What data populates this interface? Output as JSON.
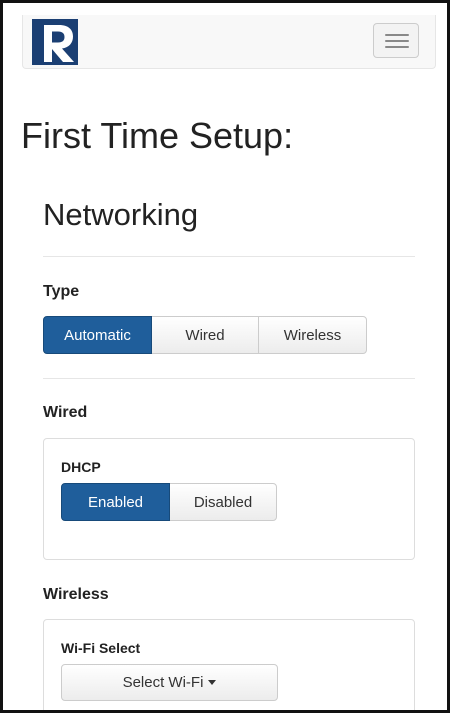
{
  "navbar": {
    "logo_letter": "R",
    "menu_icon": "hamburger-menu-icon"
  },
  "page": {
    "title": "First Time Setup:"
  },
  "networking": {
    "title": "Networking",
    "type_label": "Type",
    "type_options": [
      "Automatic",
      "Wired",
      "Wireless"
    ],
    "type_selected": "Automatic",
    "wired": {
      "title": "Wired",
      "dhcp_label": "DHCP",
      "dhcp_options": [
        "Enabled",
        "Disabled"
      ],
      "dhcp_selected": "Enabled"
    },
    "wireless": {
      "title": "Wireless",
      "wifi_label": "Wi-Fi Select",
      "wifi_select_label": "Select Wi-Fi"
    }
  },
  "colors": {
    "active_button": "#1f5e9b",
    "logo_blue": "#1b3f73"
  }
}
